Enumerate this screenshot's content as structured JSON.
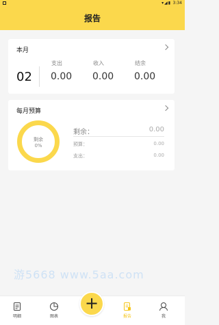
{
  "status_bar": {
    "time": "3:34"
  },
  "header": {
    "title": "报告"
  },
  "month_card": {
    "title": "本月",
    "month": "02",
    "columns": [
      {
        "label": "支出",
        "value": "0.00"
      },
      {
        "label": "收入",
        "value": "0.00"
      },
      {
        "label": "结余",
        "value": "0.00"
      }
    ]
  },
  "budget_card": {
    "title": "每月预算",
    "ring_label": "剩余",
    "ring_percent": "0%",
    "remaining_label": "剩余：",
    "remaining_value": "0.00",
    "budget_label": "预算：",
    "budget_value": "0.00",
    "expense_label": "支出：",
    "expense_value": "0.00"
  },
  "watermark": "游5668 www.5aa.com",
  "tabbar": {
    "items": [
      {
        "label": "明细"
      },
      {
        "label": "图表"
      },
      {
        "label": "报告"
      },
      {
        "label": "我"
      }
    ],
    "add_label": "+"
  },
  "colors": {
    "accent": "#fbd84c",
    "active_tab": "#f5c518"
  }
}
